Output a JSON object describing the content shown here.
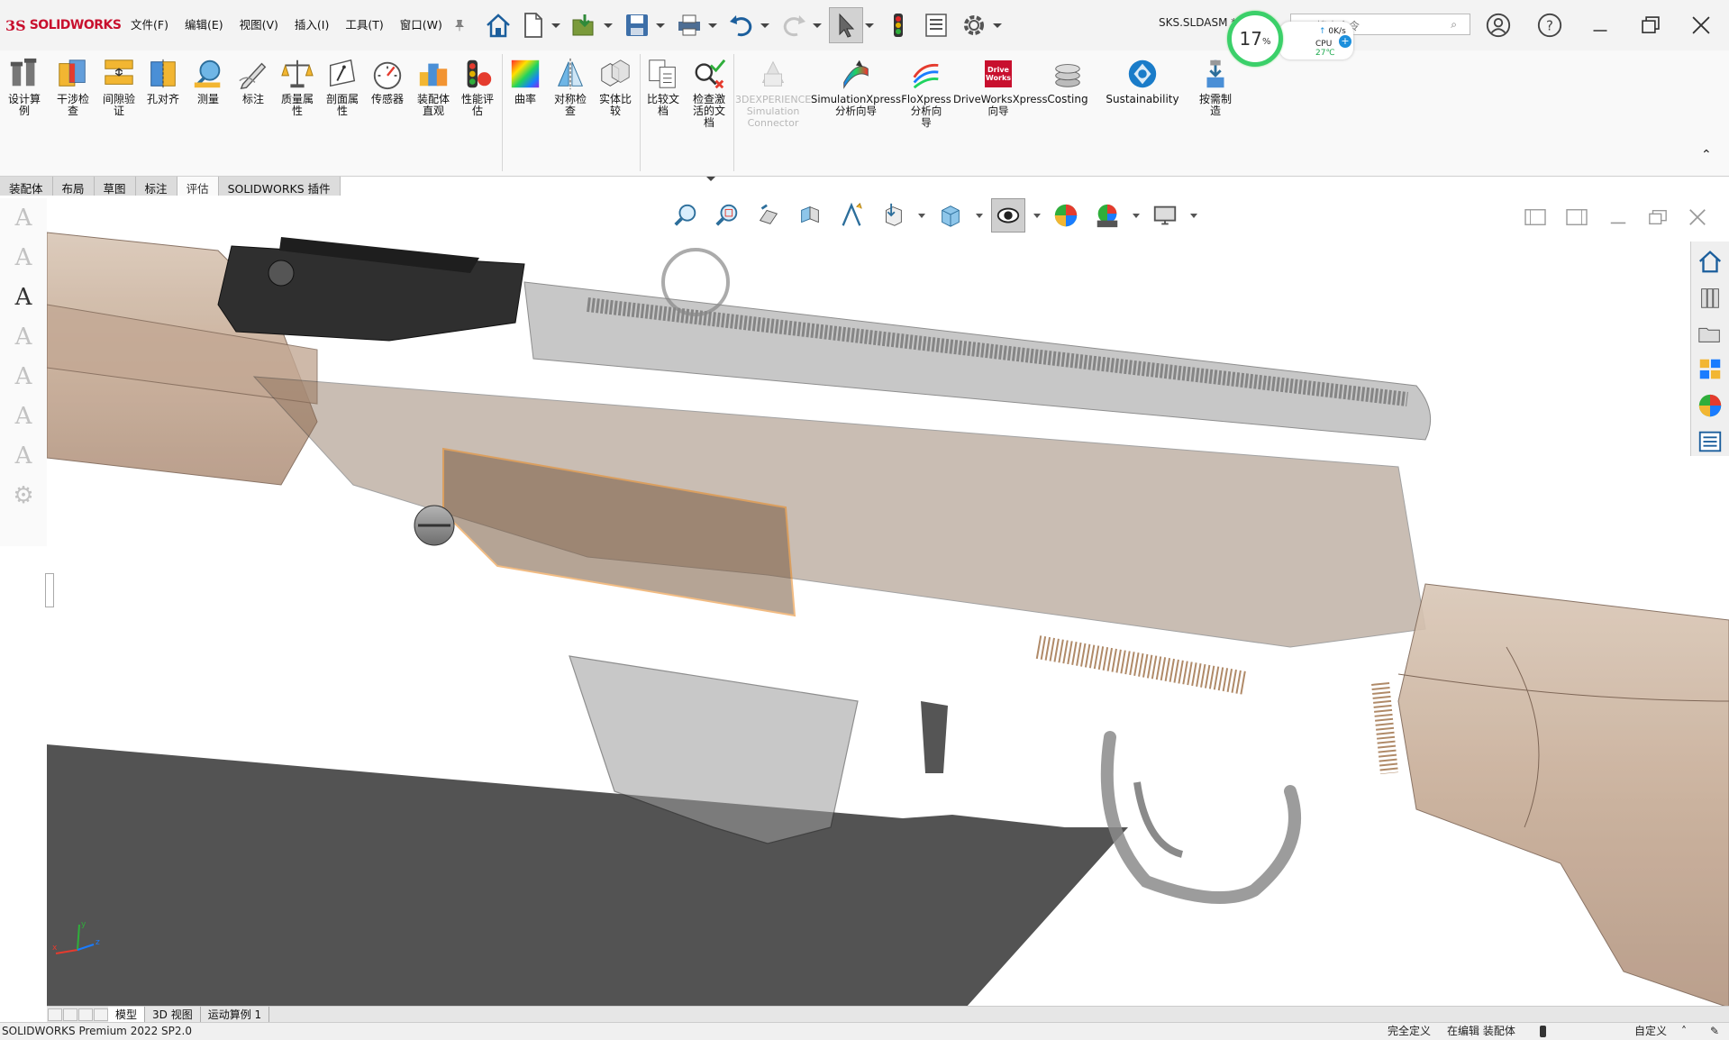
{
  "app": {
    "brand_ds": "3S",
    "brand_name": "SOLIDWORKS",
    "document_name": "SKS.SLDASM *"
  },
  "menus": [
    "文件(F)",
    "编辑(E)",
    "视图(V)",
    "插入(I)",
    "工具(T)",
    "窗口(W)"
  ],
  "cpu_widget": {
    "percent": "17",
    "percent_sign": "%",
    "net_rate": "0K/s",
    "cpu_label": "CPU",
    "cpu_temp": "27℃",
    "plus": "+"
  },
  "search": {
    "placeholder": "搜索命令"
  },
  "ribbon": {
    "items": [
      {
        "label": "设计算\n例",
        "icon": "design-study-icon"
      },
      {
        "label": "干涉检\n查",
        "icon": "interference-check-icon"
      },
      {
        "label": "间隙验\n证",
        "icon": "clearance-verification-icon"
      },
      {
        "label": "孔对齐",
        "icon": "hole-alignment-icon"
      },
      {
        "label": "测量",
        "icon": "measure-icon"
      },
      {
        "label": "标注",
        "icon": "markup-icon"
      },
      {
        "label": "质量属\n性",
        "icon": "mass-properties-icon"
      },
      {
        "label": "剖面属\n性",
        "icon": "section-properties-icon"
      },
      {
        "label": "传感器",
        "icon": "sensor-icon"
      },
      {
        "label": "装配体\n直观",
        "icon": "assembly-visualization-icon"
      },
      {
        "label": "性能评\n估",
        "icon": "performance-evaluation-icon"
      },
      {
        "label": "曲率",
        "icon": "curvature-icon"
      },
      {
        "label": "对称检\n查",
        "icon": "symmetry-check-icon"
      },
      {
        "label": "实体比\n较",
        "icon": "body-compare-icon"
      },
      {
        "label": "比较文\n档",
        "icon": "compare-documents-icon"
      },
      {
        "label": "检查激\n活的文\n档",
        "icon": "check-active-document-icon"
      },
      {
        "label": "3DEXPERIENCE\nSimulation\nConnector",
        "icon": "3dexperience-simulation-icon",
        "disabled": true
      },
      {
        "label": "SimulationXpress\n分析向导",
        "icon": "simulationxpress-icon"
      },
      {
        "label": "FloXpress\n分析向\n导",
        "icon": "floxpress-icon"
      },
      {
        "label": "DriveWorksXpress\n向导",
        "icon": "driveworksxpress-icon"
      },
      {
        "label": "Costing",
        "icon": "costing-icon"
      },
      {
        "label": "Sustainability",
        "icon": "sustainability-icon"
      },
      {
        "label": "按需制\n造",
        "icon": "manufacture-on-demand-icon"
      }
    ],
    "driveworks_badge": "Drive\nWorks"
  },
  "command_tabs": [
    "装配体",
    "布局",
    "草图",
    "标注",
    "评估",
    "SOLIDWORKS 插件"
  ],
  "active_command_tab": "评估",
  "bottom_tabs": [
    "模型",
    "3D 视图",
    "运动算例 1"
  ],
  "status": {
    "product": "SOLIDWORKS Premium 2022 SP2.0",
    "definition": "完全定义",
    "editing": "在编辑 装配体",
    "units": "自定义"
  },
  "triad": {
    "x": "x",
    "y": "y",
    "z": "z"
  },
  "colors": {
    "brand": "#c8102e",
    "cpu_ring": "#3bd06a",
    "selection": "#e8871e",
    "stock": "#c9b19e"
  }
}
